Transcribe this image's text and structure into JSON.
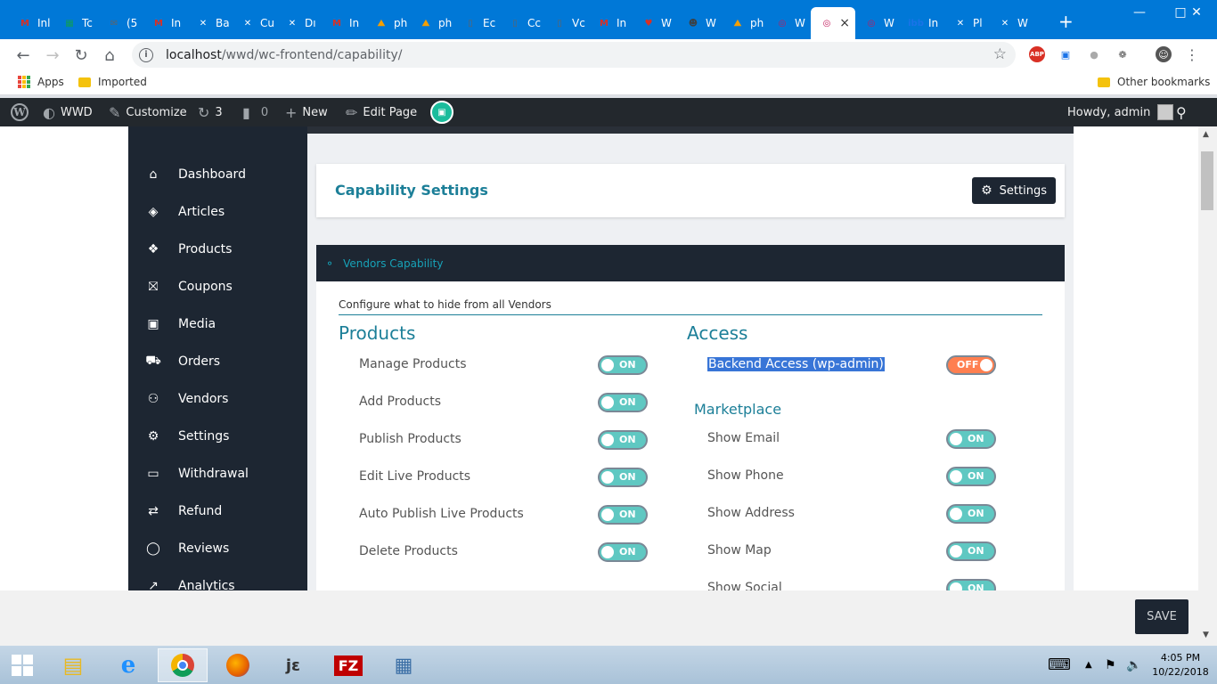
{
  "browser": {
    "tabs": [
      {
        "label": "Inl",
        "icon": "gmail-icon",
        "color": "#d93025"
      },
      {
        "label": "Tc",
        "icon": "sheets-icon",
        "color": "#0f9d58"
      },
      {
        "label": "(5",
        "icon": "mail-icon",
        "color": "#5f6368"
      },
      {
        "label": "In",
        "icon": "gmail-icon",
        "color": "#d93025"
      },
      {
        "label": "Ba",
        "icon": "c-icon",
        "color": "#ffffff"
      },
      {
        "label": "Cu",
        "icon": "c-icon",
        "color": "#ffffff"
      },
      {
        "label": "Dı",
        "icon": "c-icon",
        "color": "#ffffff"
      },
      {
        "label": "In",
        "icon": "gmail-icon",
        "color": "#d93025"
      },
      {
        "label": "ph",
        "icon": "php-icon",
        "color": "#f59f00"
      },
      {
        "label": "ph",
        "icon": "php-icon",
        "color": "#f59f00"
      },
      {
        "label": "Ec",
        "icon": "doc-icon",
        "color": "#5f6368"
      },
      {
        "label": "Cc",
        "icon": "doc-icon",
        "color": "#5f6368"
      },
      {
        "label": "Vc",
        "icon": "doc-icon",
        "color": "#5f6368"
      },
      {
        "label": "In",
        "icon": "gmail-icon",
        "color": "#d93025"
      },
      {
        "label": "W",
        "icon": "shield-icon",
        "color": "#d93025"
      },
      {
        "label": "W",
        "icon": "user-icon",
        "color": "#3c4043"
      },
      {
        "label": "ph",
        "icon": "php-icon",
        "color": "#f59f00"
      },
      {
        "label": "W",
        "icon": "wcfm-icon",
        "color": "#c2185b"
      },
      {
        "label": "",
        "icon": "wcfm-icon",
        "color": "#c2185b"
      },
      {
        "label": "W",
        "icon": "wcfm-icon",
        "color": "#c2185b"
      },
      {
        "label": "In",
        "icon": "ibb-icon",
        "color": "#1a73e8"
      },
      {
        "label": "Pl",
        "icon": "c-icon",
        "color": "#ffffff"
      },
      {
        "label": "W",
        "icon": "c-icon",
        "color": "#ffffff"
      }
    ],
    "close_tab": "×",
    "new_tab": "+",
    "url_host": "localhost",
    "url_path": "/wwd/wc-frontend/capability/",
    "bookmarks": {
      "apps": "Apps",
      "imported": "Imported",
      "other": "Other bookmarks"
    },
    "extensions": {
      "abp": "ABP"
    }
  },
  "adminbar": {
    "site": "WWD",
    "customize": "Customize",
    "updates": "3",
    "comments": "0",
    "new": "New",
    "edit_page": "Edit Page",
    "howdy": "Howdy, admin"
  },
  "sidebar": {
    "items": [
      {
        "label": "Dashboard",
        "icon": "home-icon"
      },
      {
        "label": "Articles",
        "icon": "cube-icon"
      },
      {
        "label": "Products",
        "icon": "cubes-icon"
      },
      {
        "label": "Coupons",
        "icon": "gift-icon"
      },
      {
        "label": "Media",
        "icon": "image-icon"
      },
      {
        "label": "Orders",
        "icon": "cart-icon"
      },
      {
        "label": "Vendors",
        "icon": "user-icon"
      },
      {
        "label": "Settings",
        "icon": "cogs-icon"
      },
      {
        "label": "Withdrawal",
        "icon": "card-icon"
      },
      {
        "label": "Refund",
        "icon": "retweet-icon"
      },
      {
        "label": "Reviews",
        "icon": "comments-icon"
      },
      {
        "label": "Analytics",
        "icon": "chart-icon"
      }
    ]
  },
  "main": {
    "page_title": "Capability Settings",
    "settings_button": "Settings",
    "section_title": "Vendors Capability",
    "configure_text": "Configure what to hide from all Vendors",
    "products": {
      "title": "Products",
      "options": [
        {
          "label": "Manage Products",
          "state": "ON"
        },
        {
          "label": "Add Products",
          "state": "ON"
        },
        {
          "label": "Publish Products",
          "state": "ON"
        },
        {
          "label": "Edit Live Products",
          "state": "ON"
        },
        {
          "label": "Auto Publish Live Products",
          "state": "ON"
        },
        {
          "label": "Delete Products",
          "state": "ON"
        }
      ]
    },
    "access": {
      "title": "Access",
      "backend_label": "Backend Access (wp-admin)",
      "backend_state": "OFF",
      "marketplace_title": "Marketplace",
      "options": [
        {
          "label": "Show Email",
          "state": "ON"
        },
        {
          "label": "Show Phone",
          "state": "ON"
        },
        {
          "label": "Show Address",
          "state": "ON"
        },
        {
          "label": "Show Map",
          "state": "ON"
        },
        {
          "label": "Show Social",
          "state": "ON"
        }
      ]
    },
    "save_button": "SAVE"
  },
  "taskbar": {
    "time": "4:05 PM",
    "date": "10/22/2018"
  },
  "colors": {
    "accent": "#1c7f98",
    "toggle_on": "#5fc8c2",
    "toggle_off": "#ff7f50",
    "sidebar": "#1d2632",
    "tabstrip": "#0078d7"
  }
}
